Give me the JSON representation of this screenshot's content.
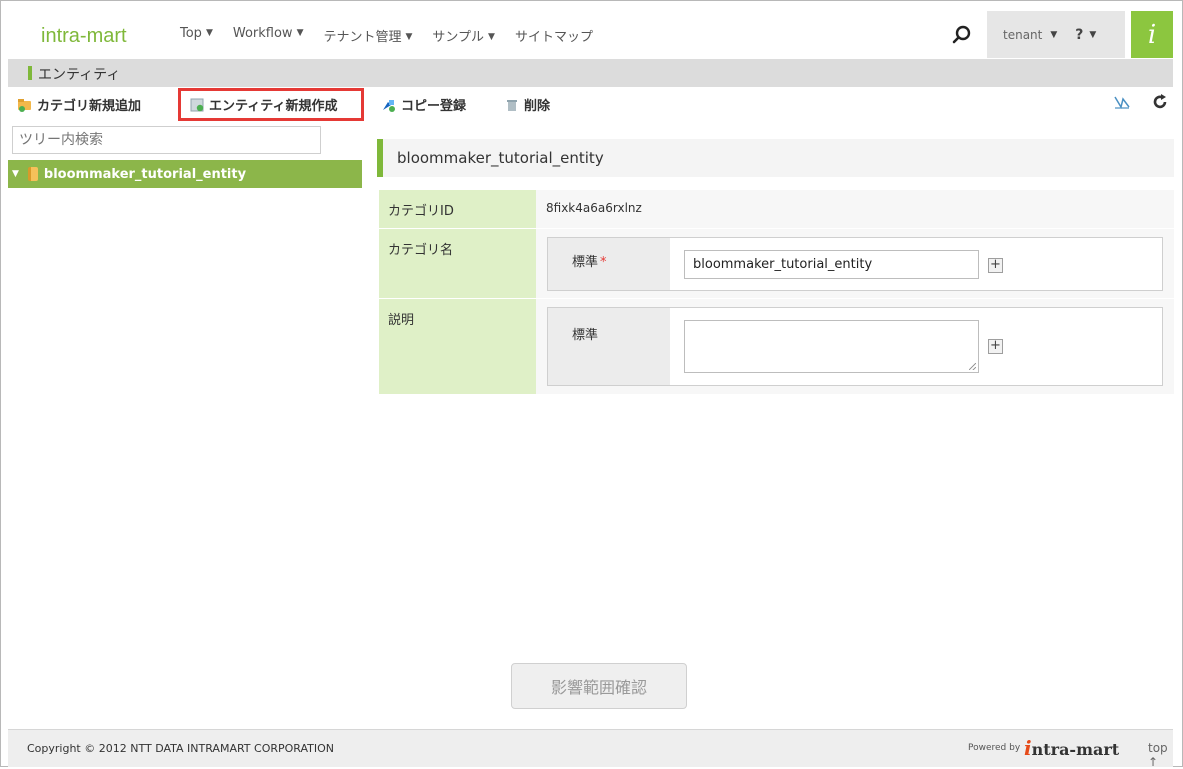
{
  "header": {
    "logo": "intra-mart",
    "nav": [
      {
        "label": "Top"
      },
      {
        "label": "Workflow"
      },
      {
        "label": "テナント管理"
      },
      {
        "label": "サンプル"
      },
      {
        "label": "サイトマップ"
      }
    ],
    "user": "tenant",
    "help": "?",
    "brand_glyph": "i"
  },
  "page": {
    "title": "エンティティ"
  },
  "toolbar": {
    "add_category": "カテゴリ新規追加",
    "new_entity": "エンティティ新規作成",
    "copy": "コピー登録",
    "delete": "削除"
  },
  "sidebar": {
    "search_placeholder": "ツリー内検索",
    "tree": [
      {
        "label": "bloommaker_tutorial_entity",
        "expanded": true,
        "selected": true
      }
    ]
  },
  "main": {
    "heading": "bloommaker_tutorial_entity",
    "rows": {
      "category_id": {
        "label": "カテゴリID",
        "value": "8fixk4a6a6rxlnz"
      },
      "category_name": {
        "label": "カテゴリ名",
        "lang_label": "標準",
        "required": "*",
        "value": "bloommaker_tutorial_entity",
        "add": "+"
      },
      "description": {
        "label": "説明",
        "lang_label": "標準",
        "value": "",
        "add": "+"
      }
    },
    "impact_button": "影響範囲確認"
  },
  "footer": {
    "copyright": "Copyright © 2012 NTT DATA INTRAMART CORPORATION",
    "powered_by": "Powered by",
    "powered_logo_i": "i",
    "powered_logo_rest": "ntra-mart",
    "top_link": "top ↑"
  },
  "colors": {
    "accent": "#7fb83a",
    "highlight_border": "#e53935",
    "label_bg": "#dff0c7"
  },
  "icons": [
    "search-icon",
    "folder-add-icon",
    "document-add-icon",
    "copy-icon",
    "trash-icon",
    "diagram-icon",
    "refresh-icon",
    "folder-icon",
    "expand-arrow-icon"
  ]
}
